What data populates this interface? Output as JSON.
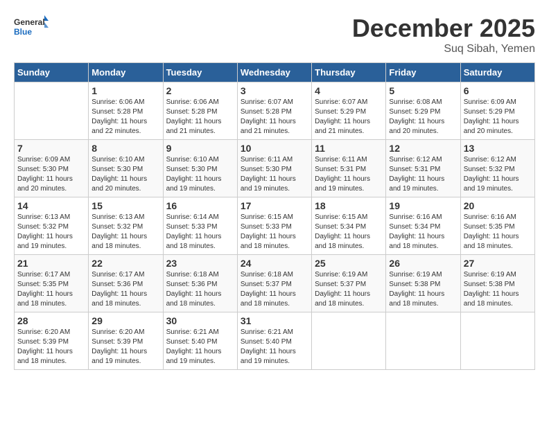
{
  "logo": {
    "text_general": "General",
    "text_blue": "Blue"
  },
  "header": {
    "month": "December 2025",
    "location": "Suq Sibah, Yemen"
  },
  "weekdays": [
    "Sunday",
    "Monday",
    "Tuesday",
    "Wednesday",
    "Thursday",
    "Friday",
    "Saturday"
  ],
  "weeks": [
    [
      {
        "day": "",
        "sunrise": "",
        "sunset": "",
        "daylight": ""
      },
      {
        "day": "1",
        "sunrise": "Sunrise: 6:06 AM",
        "sunset": "Sunset: 5:28 PM",
        "daylight": "Daylight: 11 hours and 22 minutes."
      },
      {
        "day": "2",
        "sunrise": "Sunrise: 6:06 AM",
        "sunset": "Sunset: 5:28 PM",
        "daylight": "Daylight: 11 hours and 21 minutes."
      },
      {
        "day": "3",
        "sunrise": "Sunrise: 6:07 AM",
        "sunset": "Sunset: 5:28 PM",
        "daylight": "Daylight: 11 hours and 21 minutes."
      },
      {
        "day": "4",
        "sunrise": "Sunrise: 6:07 AM",
        "sunset": "Sunset: 5:29 PM",
        "daylight": "Daylight: 11 hours and 21 minutes."
      },
      {
        "day": "5",
        "sunrise": "Sunrise: 6:08 AM",
        "sunset": "Sunset: 5:29 PM",
        "daylight": "Daylight: 11 hours and 20 minutes."
      },
      {
        "day": "6",
        "sunrise": "Sunrise: 6:09 AM",
        "sunset": "Sunset: 5:29 PM",
        "daylight": "Daylight: 11 hours and 20 minutes."
      }
    ],
    [
      {
        "day": "7",
        "sunrise": "Sunrise: 6:09 AM",
        "sunset": "Sunset: 5:30 PM",
        "daylight": "Daylight: 11 hours and 20 minutes."
      },
      {
        "day": "8",
        "sunrise": "Sunrise: 6:10 AM",
        "sunset": "Sunset: 5:30 PM",
        "daylight": "Daylight: 11 hours and 20 minutes."
      },
      {
        "day": "9",
        "sunrise": "Sunrise: 6:10 AM",
        "sunset": "Sunset: 5:30 PM",
        "daylight": "Daylight: 11 hours and 19 minutes."
      },
      {
        "day": "10",
        "sunrise": "Sunrise: 6:11 AM",
        "sunset": "Sunset: 5:30 PM",
        "daylight": "Daylight: 11 hours and 19 minutes."
      },
      {
        "day": "11",
        "sunrise": "Sunrise: 6:11 AM",
        "sunset": "Sunset: 5:31 PM",
        "daylight": "Daylight: 11 hours and 19 minutes."
      },
      {
        "day": "12",
        "sunrise": "Sunrise: 6:12 AM",
        "sunset": "Sunset: 5:31 PM",
        "daylight": "Daylight: 11 hours and 19 minutes."
      },
      {
        "day": "13",
        "sunrise": "Sunrise: 6:12 AM",
        "sunset": "Sunset: 5:32 PM",
        "daylight": "Daylight: 11 hours and 19 minutes."
      }
    ],
    [
      {
        "day": "14",
        "sunrise": "Sunrise: 6:13 AM",
        "sunset": "Sunset: 5:32 PM",
        "daylight": "Daylight: 11 hours and 19 minutes."
      },
      {
        "day": "15",
        "sunrise": "Sunrise: 6:13 AM",
        "sunset": "Sunset: 5:32 PM",
        "daylight": "Daylight: 11 hours and 18 minutes."
      },
      {
        "day": "16",
        "sunrise": "Sunrise: 6:14 AM",
        "sunset": "Sunset: 5:33 PM",
        "daylight": "Daylight: 11 hours and 18 minutes."
      },
      {
        "day": "17",
        "sunrise": "Sunrise: 6:15 AM",
        "sunset": "Sunset: 5:33 PM",
        "daylight": "Daylight: 11 hours and 18 minutes."
      },
      {
        "day": "18",
        "sunrise": "Sunrise: 6:15 AM",
        "sunset": "Sunset: 5:34 PM",
        "daylight": "Daylight: 11 hours and 18 minutes."
      },
      {
        "day": "19",
        "sunrise": "Sunrise: 6:16 AM",
        "sunset": "Sunset: 5:34 PM",
        "daylight": "Daylight: 11 hours and 18 minutes."
      },
      {
        "day": "20",
        "sunrise": "Sunrise: 6:16 AM",
        "sunset": "Sunset: 5:35 PM",
        "daylight": "Daylight: 11 hours and 18 minutes."
      }
    ],
    [
      {
        "day": "21",
        "sunrise": "Sunrise: 6:17 AM",
        "sunset": "Sunset: 5:35 PM",
        "daylight": "Daylight: 11 hours and 18 minutes."
      },
      {
        "day": "22",
        "sunrise": "Sunrise: 6:17 AM",
        "sunset": "Sunset: 5:36 PM",
        "daylight": "Daylight: 11 hours and 18 minutes."
      },
      {
        "day": "23",
        "sunrise": "Sunrise: 6:18 AM",
        "sunset": "Sunset: 5:36 PM",
        "daylight": "Daylight: 11 hours and 18 minutes."
      },
      {
        "day": "24",
        "sunrise": "Sunrise: 6:18 AM",
        "sunset": "Sunset: 5:37 PM",
        "daylight": "Daylight: 11 hours and 18 minutes."
      },
      {
        "day": "25",
        "sunrise": "Sunrise: 6:19 AM",
        "sunset": "Sunset: 5:37 PM",
        "daylight": "Daylight: 11 hours and 18 minutes."
      },
      {
        "day": "26",
        "sunrise": "Sunrise: 6:19 AM",
        "sunset": "Sunset: 5:38 PM",
        "daylight": "Daylight: 11 hours and 18 minutes."
      },
      {
        "day": "27",
        "sunrise": "Sunrise: 6:19 AM",
        "sunset": "Sunset: 5:38 PM",
        "daylight": "Daylight: 11 hours and 18 minutes."
      }
    ],
    [
      {
        "day": "28",
        "sunrise": "Sunrise: 6:20 AM",
        "sunset": "Sunset: 5:39 PM",
        "daylight": "Daylight: 11 hours and 18 minutes."
      },
      {
        "day": "29",
        "sunrise": "Sunrise: 6:20 AM",
        "sunset": "Sunset: 5:39 PM",
        "daylight": "Daylight: 11 hours and 19 minutes."
      },
      {
        "day": "30",
        "sunrise": "Sunrise: 6:21 AM",
        "sunset": "Sunset: 5:40 PM",
        "daylight": "Daylight: 11 hours and 19 minutes."
      },
      {
        "day": "31",
        "sunrise": "Sunrise: 6:21 AM",
        "sunset": "Sunset: 5:40 PM",
        "daylight": "Daylight: 11 hours and 19 minutes."
      },
      {
        "day": "",
        "sunrise": "",
        "sunset": "",
        "daylight": ""
      },
      {
        "day": "",
        "sunrise": "",
        "sunset": "",
        "daylight": ""
      },
      {
        "day": "",
        "sunrise": "",
        "sunset": "",
        "daylight": ""
      }
    ]
  ]
}
